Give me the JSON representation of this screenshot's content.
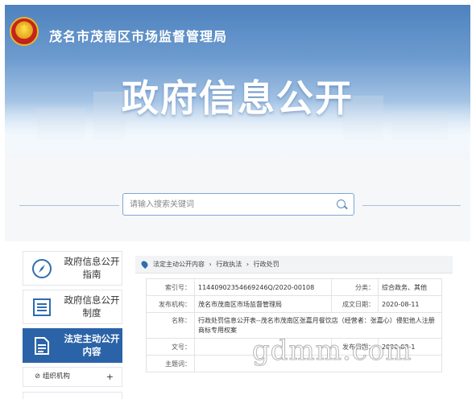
{
  "banner": {
    "bureau_name": "茂名市茂南区市场监督管理局",
    "title": "政府信息公开"
  },
  "search": {
    "placeholder": "请输入搜索关键词",
    "icon": "search-icon"
  },
  "sidebar": {
    "items": [
      {
        "label": "政府信息公开指南",
        "icon": "compass-icon"
      },
      {
        "label": "政府信息公开制度",
        "icon": "list-icon"
      },
      {
        "label": "法定主动公开内容",
        "icon": "document-icon",
        "active": true
      }
    ],
    "sub_item": {
      "label": "组织机构",
      "icon": "chain-icon",
      "toggle": "+"
    }
  },
  "breadcrumb": {
    "items": [
      "法定主动公开内容",
      "行政执法",
      "行政处罚"
    ],
    "separator": "›"
  },
  "info": {
    "index_label": "索引号：",
    "index_value": "11440902354669246Q/2020-00108",
    "category_label": "分类：",
    "category_value": "综合政务、其他",
    "publisher_label": "发布机构：",
    "publisher_value": "茂名市茂南区市场监督管理局",
    "date_label": "成文日期：",
    "date_value": "2020-08-11",
    "name_label": "名称：",
    "name_value": "行政处罚信息公开表--茂名市茂南区张嘉月餐饮店（经营者：张嘉心）侵犯他人注册商标专用权案",
    "docno_label": "文号：",
    "docno_value": "",
    "pubdate_label": "发布日期：",
    "pubdate_value": "2020-08-1",
    "subject_label": "主题词：",
    "subject_value": ""
  },
  "watermark": "gdmm.com",
  "colors": {
    "accent": "#2b63a8",
    "border": "#7fa6d2",
    "banner_top": "#4e82be"
  }
}
